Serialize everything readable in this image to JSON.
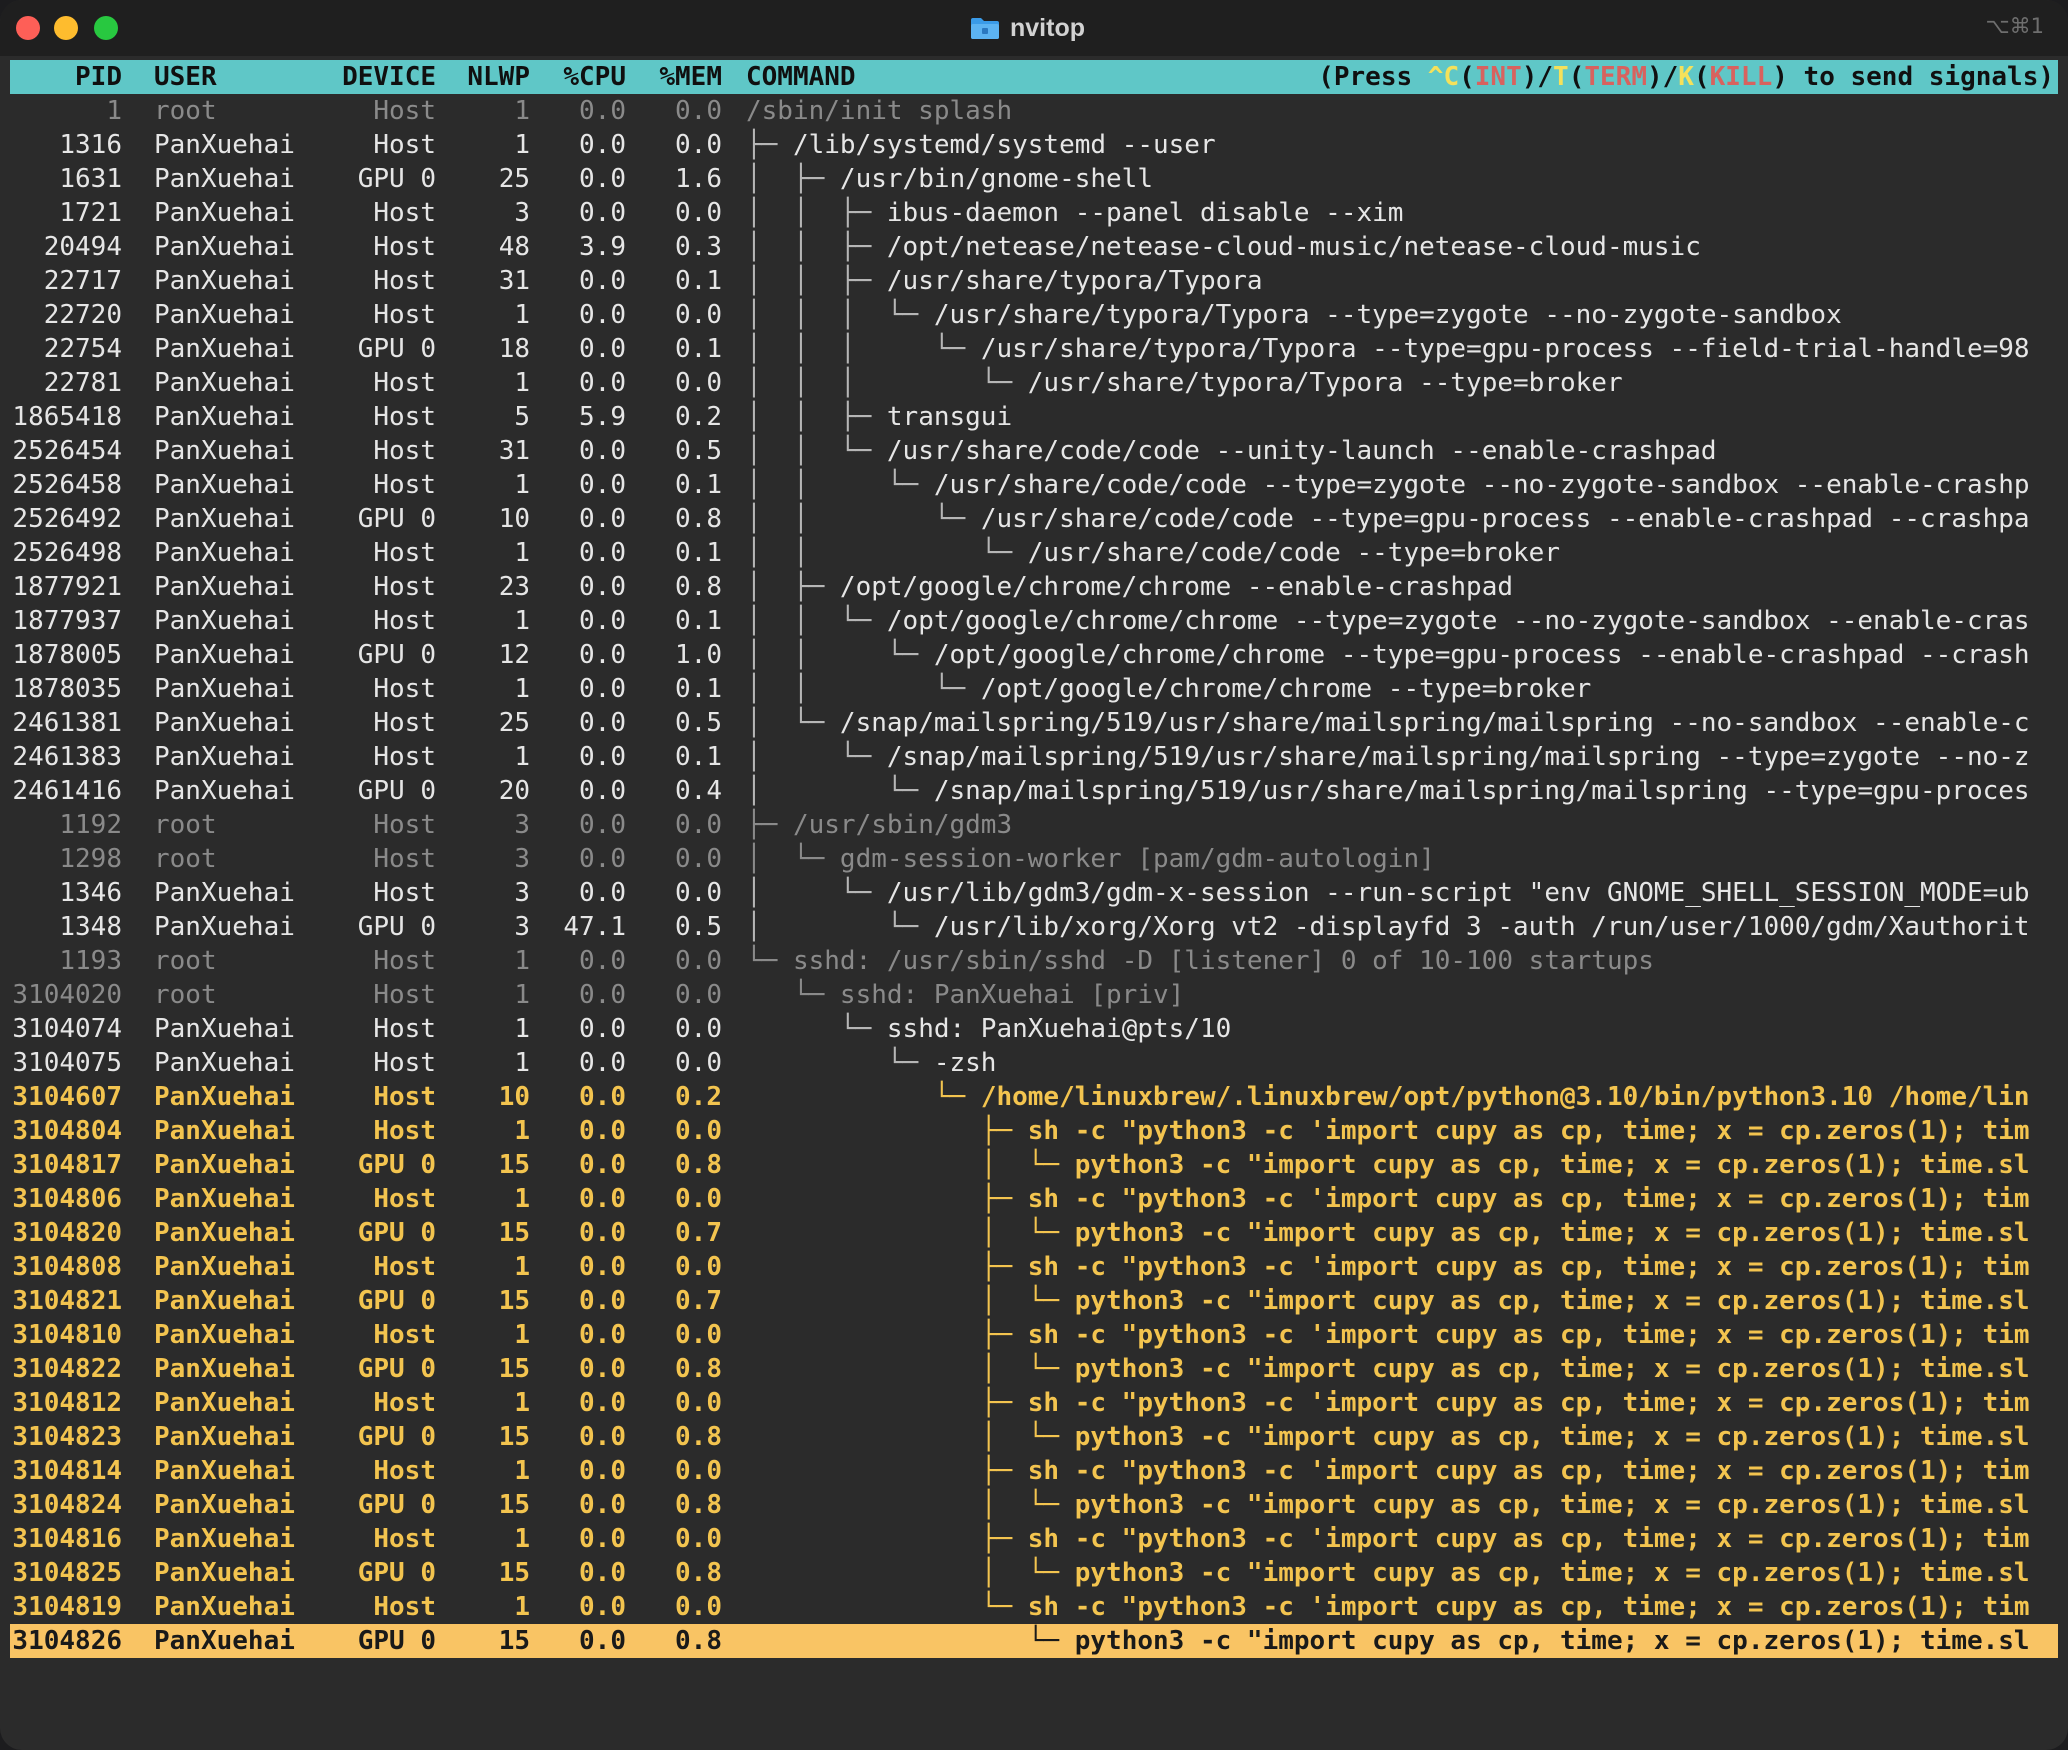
{
  "window": {
    "title": "nvitop",
    "shortcut": "⌥⌘1",
    "folder_icon": "folder-icon",
    "colors": {
      "accent": "#5fc7c7",
      "highlight": "#f9c464",
      "user_process": "#f3c44f"
    }
  },
  "header": {
    "columns": [
      "PID",
      "USER",
      "DEVICE",
      "NLWP",
      "%CPU",
      "%MEM",
      "COMMAND"
    ],
    "hint_parts": {
      "a": "(Press ",
      "b": "^C",
      "c": "(",
      "d": "INT",
      "e": ")/",
      "f": "T",
      "g": "(",
      "h": "TERM",
      "i": ")/",
      "j": "K",
      "k": "(",
      "l": "KILL",
      "m": ") to send signals)"
    }
  },
  "rows": [
    {
      "pid": "1",
      "user": "root",
      "device": "Host",
      "nlwp": "1",
      "cpu": "0.0",
      "mem": "0.0",
      "tree": "",
      "cmd": "/sbin/init splash",
      "style": "g"
    },
    {
      "pid": "1316",
      "user": "PanXuehai",
      "device": "Host",
      "nlwp": "1",
      "cpu": "0.0",
      "mem": "0.0",
      "tree": "├─ ",
      "cmd": "/lib/systemd/systemd --user",
      "style": "n"
    },
    {
      "pid": "1631",
      "user": "PanXuehai",
      "device": "GPU 0",
      "nlwp": "25",
      "cpu": "0.0",
      "mem": "1.6",
      "tree": "│  ├─ ",
      "cmd": "/usr/bin/gnome-shell",
      "style": "n"
    },
    {
      "pid": "1721",
      "user": "PanXuehai",
      "device": "Host",
      "nlwp": "3",
      "cpu": "0.0",
      "mem": "0.0",
      "tree": "│  │  ├─ ",
      "cmd": "ibus-daemon --panel disable --xim",
      "style": "n"
    },
    {
      "pid": "20494",
      "user": "PanXuehai",
      "device": "Host",
      "nlwp": "48",
      "cpu": "3.9",
      "mem": "0.3",
      "tree": "│  │  ├─ ",
      "cmd": "/opt/netease/netease-cloud-music/netease-cloud-music",
      "style": "n"
    },
    {
      "pid": "22717",
      "user": "PanXuehai",
      "device": "Host",
      "nlwp": "31",
      "cpu": "0.0",
      "mem": "0.1",
      "tree": "│  │  ├─ ",
      "cmd": "/usr/share/typora/Typora",
      "style": "n"
    },
    {
      "pid": "22720",
      "user": "PanXuehai",
      "device": "Host",
      "nlwp": "1",
      "cpu": "0.0",
      "mem": "0.0",
      "tree": "│  │  │  └─ ",
      "cmd": "/usr/share/typora/Typora --type=zygote --no-zygote-sandbox",
      "style": "n"
    },
    {
      "pid": "22754",
      "user": "PanXuehai",
      "device": "GPU 0",
      "nlwp": "18",
      "cpu": "0.0",
      "mem": "0.1",
      "tree": "│  │  │     └─ ",
      "cmd": "/usr/share/typora/Typora --type=gpu-process --field-trial-handle=98",
      "style": "n"
    },
    {
      "pid": "22781",
      "user": "PanXuehai",
      "device": "Host",
      "nlwp": "1",
      "cpu": "0.0",
      "mem": "0.0",
      "tree": "│  │  │        └─ ",
      "cmd": "/usr/share/typora/Typora --type=broker",
      "style": "n"
    },
    {
      "pid": "1865418",
      "user": "PanXuehai",
      "device": "Host",
      "nlwp": "5",
      "cpu": "5.9",
      "mem": "0.2",
      "tree": "│  │  ├─ ",
      "cmd": "transgui",
      "style": "n"
    },
    {
      "pid": "2526454",
      "user": "PanXuehai",
      "device": "Host",
      "nlwp": "31",
      "cpu": "0.0",
      "mem": "0.5",
      "tree": "│  │  └─ ",
      "cmd": "/usr/share/code/code --unity-launch --enable-crashpad",
      "style": "n"
    },
    {
      "pid": "2526458",
      "user": "PanXuehai",
      "device": "Host",
      "nlwp": "1",
      "cpu": "0.0",
      "mem": "0.1",
      "tree": "│  │     └─ ",
      "cmd": "/usr/share/code/code --type=zygote --no-zygote-sandbox --enable-crashp",
      "style": "n"
    },
    {
      "pid": "2526492",
      "user": "PanXuehai",
      "device": "GPU 0",
      "nlwp": "10",
      "cpu": "0.0",
      "mem": "0.8",
      "tree": "│  │        └─ ",
      "cmd": "/usr/share/code/code --type=gpu-process --enable-crashpad --crashpa",
      "style": "n"
    },
    {
      "pid": "2526498",
      "user": "PanXuehai",
      "device": "Host",
      "nlwp": "1",
      "cpu": "0.0",
      "mem": "0.1",
      "tree": "│  │           └─ ",
      "cmd": "/usr/share/code/code --type=broker",
      "style": "n"
    },
    {
      "pid": "1877921",
      "user": "PanXuehai",
      "device": "Host",
      "nlwp": "23",
      "cpu": "0.0",
      "mem": "0.8",
      "tree": "│  ├─ ",
      "cmd": "/opt/google/chrome/chrome --enable-crashpad",
      "style": "n"
    },
    {
      "pid": "1877937",
      "user": "PanXuehai",
      "device": "Host",
      "nlwp": "1",
      "cpu": "0.0",
      "mem": "0.1",
      "tree": "│  │  └─ ",
      "cmd": "/opt/google/chrome/chrome --type=zygote --no-zygote-sandbox --enable-cras",
      "style": "n"
    },
    {
      "pid": "1878005",
      "user": "PanXuehai",
      "device": "GPU 0",
      "nlwp": "12",
      "cpu": "0.0",
      "mem": "1.0",
      "tree": "│  │     └─ ",
      "cmd": "/opt/google/chrome/chrome --type=gpu-process --enable-crashpad --crash",
      "style": "n"
    },
    {
      "pid": "1878035",
      "user": "PanXuehai",
      "device": "Host",
      "nlwp": "1",
      "cpu": "0.0",
      "mem": "0.1",
      "tree": "│  │        └─ ",
      "cmd": "/opt/google/chrome/chrome --type=broker",
      "style": "n"
    },
    {
      "pid": "2461381",
      "user": "PanXuehai",
      "device": "Host",
      "nlwp": "25",
      "cpu": "0.0",
      "mem": "0.5",
      "tree": "│  └─ ",
      "cmd": "/snap/mailspring/519/usr/share/mailspring/mailspring --no-sandbox --enable-c",
      "style": "n"
    },
    {
      "pid": "2461383",
      "user": "PanXuehai",
      "device": "Host",
      "nlwp": "1",
      "cpu": "0.0",
      "mem": "0.1",
      "tree": "│     └─ ",
      "cmd": "/snap/mailspring/519/usr/share/mailspring/mailspring --type=zygote --no-z",
      "style": "n"
    },
    {
      "pid": "2461416",
      "user": "PanXuehai",
      "device": "GPU 0",
      "nlwp": "20",
      "cpu": "0.0",
      "mem": "0.4",
      "tree": "│        └─ ",
      "cmd": "/snap/mailspring/519/usr/share/mailspring/mailspring --type=gpu-proces",
      "style": "n"
    },
    {
      "pid": "1192",
      "user": "root",
      "device": "Host",
      "nlwp": "3",
      "cpu": "0.0",
      "mem": "0.0",
      "tree": "├─ ",
      "cmd": "/usr/sbin/gdm3",
      "style": "g"
    },
    {
      "pid": "1298",
      "user": "root",
      "device": "Host",
      "nlwp": "3",
      "cpu": "0.0",
      "mem": "0.0",
      "tree": "│  └─ ",
      "cmd": "gdm-session-worker [pam/gdm-autologin]",
      "style": "g"
    },
    {
      "pid": "1346",
      "user": "PanXuehai",
      "device": "Host",
      "nlwp": "3",
      "cpu": "0.0",
      "mem": "0.0",
      "tree": "│     └─ ",
      "cmd": "/usr/lib/gdm3/gdm-x-session --run-script \"env GNOME_SHELL_SESSION_MODE=ub",
      "style": "n"
    },
    {
      "pid": "1348",
      "user": "PanXuehai",
      "device": "GPU 0",
      "nlwp": "3",
      "cpu": "47.1",
      "mem": "0.5",
      "tree": "│        └─ ",
      "cmd": "/usr/lib/xorg/Xorg vt2 -displayfd 3 -auth /run/user/1000/gdm/Xauthorit",
      "style": "n"
    },
    {
      "pid": "1193",
      "user": "root",
      "device": "Host",
      "nlwp": "1",
      "cpu": "0.0",
      "mem": "0.0",
      "tree": "└─ ",
      "cmd": "sshd: /usr/sbin/sshd -D [listener] 0 of 10-100 startups",
      "style": "g"
    },
    {
      "pid": "3104020",
      "user": "root",
      "device": "Host",
      "nlwp": "1",
      "cpu": "0.0",
      "mem": "0.0",
      "tree": "   └─ ",
      "cmd": "sshd: PanXuehai [priv]",
      "style": "g"
    },
    {
      "pid": "3104074",
      "user": "PanXuehai",
      "device": "Host",
      "nlwp": "1",
      "cpu": "0.0",
      "mem": "0.0",
      "tree": "      └─ ",
      "cmd": "sshd: PanXuehai@pts/10",
      "style": "n"
    },
    {
      "pid": "3104075",
      "user": "PanXuehai",
      "device": "Host",
      "nlwp": "1",
      "cpu": "0.0",
      "mem": "0.0",
      "tree": "         └─ ",
      "cmd": "-zsh",
      "style": "n"
    },
    {
      "pid": "3104607",
      "user": "PanXuehai",
      "device": "Host",
      "nlwp": "10",
      "cpu": "0.0",
      "mem": "0.2",
      "tree": "            └─ ",
      "cmd": "/home/linuxbrew/.linuxbrew/opt/python@3.10/bin/python3.10 /home/lin",
      "style": "b"
    },
    {
      "pid": "3104804",
      "user": "PanXuehai",
      "device": "Host",
      "nlwp": "1",
      "cpu": "0.0",
      "mem": "0.0",
      "tree": "               ├─ ",
      "cmd": "sh -c \"python3 -c 'import cupy as cp, time; x = cp.zeros(1); tim",
      "style": "b"
    },
    {
      "pid": "3104817",
      "user": "PanXuehai",
      "device": "GPU 0",
      "nlwp": "15",
      "cpu": "0.0",
      "mem": "0.8",
      "tree": "               │  └─ ",
      "cmd": "python3 -c \"import cupy as cp, time; x = cp.zeros(1); time.sl",
      "style": "b"
    },
    {
      "pid": "3104806",
      "user": "PanXuehai",
      "device": "Host",
      "nlwp": "1",
      "cpu": "0.0",
      "mem": "0.0",
      "tree": "               ├─ ",
      "cmd": "sh -c \"python3 -c 'import cupy as cp, time; x = cp.zeros(1); tim",
      "style": "b"
    },
    {
      "pid": "3104820",
      "user": "PanXuehai",
      "device": "GPU 0",
      "nlwp": "15",
      "cpu": "0.0",
      "mem": "0.7",
      "tree": "               │  └─ ",
      "cmd": "python3 -c \"import cupy as cp, time; x = cp.zeros(1); time.sl",
      "style": "b"
    },
    {
      "pid": "3104808",
      "user": "PanXuehai",
      "device": "Host",
      "nlwp": "1",
      "cpu": "0.0",
      "mem": "0.0",
      "tree": "               ├─ ",
      "cmd": "sh -c \"python3 -c 'import cupy as cp, time; x = cp.zeros(1); tim",
      "style": "b"
    },
    {
      "pid": "3104821",
      "user": "PanXuehai",
      "device": "GPU 0",
      "nlwp": "15",
      "cpu": "0.0",
      "mem": "0.7",
      "tree": "               │  └─ ",
      "cmd": "python3 -c \"import cupy as cp, time; x = cp.zeros(1); time.sl",
      "style": "b"
    },
    {
      "pid": "3104810",
      "user": "PanXuehai",
      "device": "Host",
      "nlwp": "1",
      "cpu": "0.0",
      "mem": "0.0",
      "tree": "               ├─ ",
      "cmd": "sh -c \"python3 -c 'import cupy as cp, time; x = cp.zeros(1); tim",
      "style": "b"
    },
    {
      "pid": "3104822",
      "user": "PanXuehai",
      "device": "GPU 0",
      "nlwp": "15",
      "cpu": "0.0",
      "mem": "0.8",
      "tree": "               │  └─ ",
      "cmd": "python3 -c \"import cupy as cp, time; x = cp.zeros(1); time.sl",
      "style": "b"
    },
    {
      "pid": "3104812",
      "user": "PanXuehai",
      "device": "Host",
      "nlwp": "1",
      "cpu": "0.0",
      "mem": "0.0",
      "tree": "               ├─ ",
      "cmd": "sh -c \"python3 -c 'import cupy as cp, time; x = cp.zeros(1); tim",
      "style": "b"
    },
    {
      "pid": "3104823",
      "user": "PanXuehai",
      "device": "GPU 0",
      "nlwp": "15",
      "cpu": "0.0",
      "mem": "0.8",
      "tree": "               │  └─ ",
      "cmd": "python3 -c \"import cupy as cp, time; x = cp.zeros(1); time.sl",
      "style": "b"
    },
    {
      "pid": "3104814",
      "user": "PanXuehai",
      "device": "Host",
      "nlwp": "1",
      "cpu": "0.0",
      "mem": "0.0",
      "tree": "               ├─ ",
      "cmd": "sh -c \"python3 -c 'import cupy as cp, time; x = cp.zeros(1); tim",
      "style": "b"
    },
    {
      "pid": "3104824",
      "user": "PanXuehai",
      "device": "GPU 0",
      "nlwp": "15",
      "cpu": "0.0",
      "mem": "0.8",
      "tree": "               │  └─ ",
      "cmd": "python3 -c \"import cupy as cp, time; x = cp.zeros(1); time.sl",
      "style": "b"
    },
    {
      "pid": "3104816",
      "user": "PanXuehai",
      "device": "Host",
      "nlwp": "1",
      "cpu": "0.0",
      "mem": "0.0",
      "tree": "               ├─ ",
      "cmd": "sh -c \"python3 -c 'import cupy as cp, time; x = cp.zeros(1); tim",
      "style": "b"
    },
    {
      "pid": "3104825",
      "user": "PanXuehai",
      "device": "GPU 0",
      "nlwp": "15",
      "cpu": "0.0",
      "mem": "0.8",
      "tree": "               │  └─ ",
      "cmd": "python3 -c \"import cupy as cp, time; x = cp.zeros(1); time.sl",
      "style": "b"
    },
    {
      "pid": "3104819",
      "user": "PanXuehai",
      "device": "Host",
      "nlwp": "1",
      "cpu": "0.0",
      "mem": "0.0",
      "tree": "               └─ ",
      "cmd": "sh -c \"python3 -c 'import cupy as cp, time; x = cp.zeros(1); tim",
      "style": "b"
    },
    {
      "pid": "3104826",
      "user": "PanXuehai",
      "device": "GPU 0",
      "nlwp": "15",
      "cpu": "0.0",
      "mem": "0.8",
      "tree": "                  └─ ",
      "cmd": "python3 -c \"import cupy as cp, time; x = cp.zeros(1); time.sl",
      "style": "sel"
    }
  ]
}
